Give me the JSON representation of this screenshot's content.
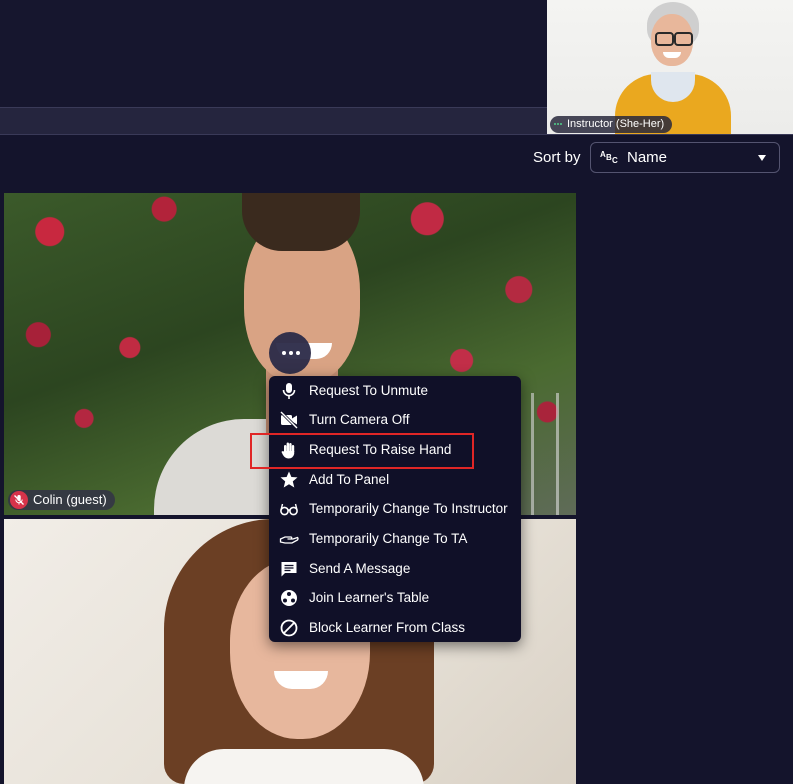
{
  "instructor": {
    "name_label": "Instructor (She-Her)"
  },
  "sort": {
    "label": "Sort by",
    "selected": "Name",
    "icon": "abc-sort-icon"
  },
  "tiles": [
    {
      "name": "Colin (guest)",
      "mic": "muted"
    }
  ],
  "menu": {
    "items": [
      {
        "label": "Request To Unmute",
        "icon": "microphone-icon"
      },
      {
        "label": "Turn Camera Off",
        "icon": "camera-off-icon"
      },
      {
        "label": "Request To Raise Hand",
        "icon": "raise-hand-icon"
      },
      {
        "label": "Add To Panel",
        "icon": "star-icon"
      },
      {
        "label": "Temporarily Change To Instructor",
        "icon": "glasses-icon"
      },
      {
        "label": "Temporarily Change To TA",
        "icon": "helping-hand-icon"
      },
      {
        "label": "Send A Message",
        "icon": "message-icon"
      },
      {
        "label": "Join Learner's Table",
        "icon": "table-icon"
      },
      {
        "label": "Block Learner From Class",
        "icon": "block-icon"
      }
    ],
    "highlighted_item": "Request To Raise Hand"
  },
  "colors": {
    "background": "#14142c",
    "menu_background": "#101028",
    "highlight": "#e02626",
    "muted_mic": "#d6334a"
  }
}
